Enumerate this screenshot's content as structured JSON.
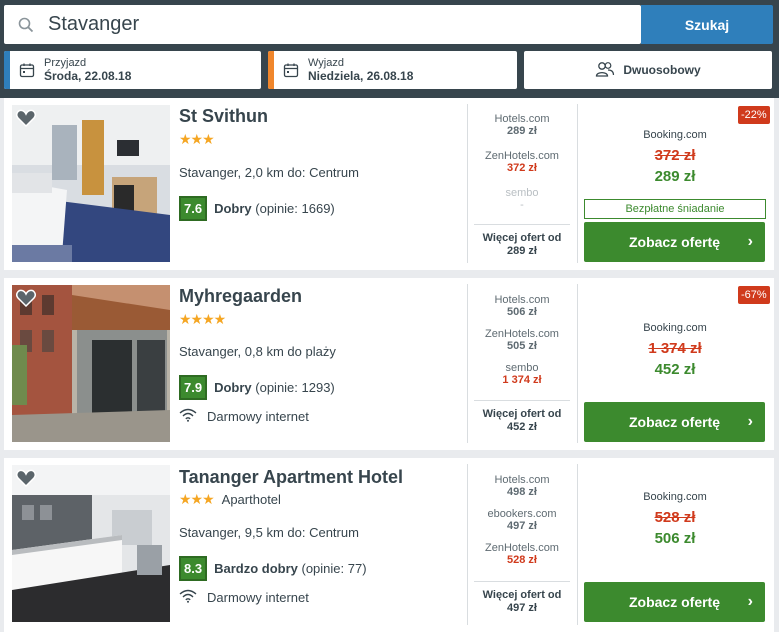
{
  "search": {
    "value": "Stavanger",
    "button_label": "Szukaj"
  },
  "checkin": {
    "label": "Przyjazd",
    "value": "Środa, 22.08.18",
    "accent": "#2f7fbb"
  },
  "checkout": {
    "label": "Wyjazd",
    "value": "Niedziela, 26.08.18",
    "accent": "#f0862c"
  },
  "room": {
    "value": "Dwuosobowy"
  },
  "hotels": [
    {
      "name": "St Svithun",
      "stars": "★★★",
      "type": "",
      "location": "Stavanger, 2,0 km do: Centrum",
      "score": "7.6",
      "rating_word": "Dobry",
      "reviews": "(opinie: 1669)",
      "amenity": "",
      "offers": [
        {
          "site": "Hotels.com",
          "price": "289 zł"
        },
        {
          "site": "ZenHotels.com",
          "price": "372 zł"
        },
        {
          "site": "sembo",
          "price": "-"
        }
      ],
      "more_label": "Więcej ofert od",
      "more_price": "289 zł",
      "discount": "-22%",
      "main_site": "Booking.com",
      "old_price": "372 zł",
      "new_price": "289 zł",
      "breakfast": "Bezpłatne śniadanie",
      "cta": "Zobacz ofertę"
    },
    {
      "name": "Myhregaarden",
      "stars": "★★★★",
      "type": "",
      "location": "Stavanger, 0,8 km do plaży",
      "score": "7.9",
      "rating_word": "Dobry",
      "reviews": "(opinie: 1293)",
      "amenity": "Darmowy internet",
      "offers": [
        {
          "site": "Hotels.com",
          "price": "506 zł"
        },
        {
          "site": "ZenHotels.com",
          "price": "505 zł"
        },
        {
          "site": "sembo",
          "price": "1 374 zł"
        }
      ],
      "more_label": "Więcej ofert od",
      "more_price": "452 zł",
      "discount": "-67%",
      "main_site": "Booking.com",
      "old_price": "1 374 zł",
      "new_price": "452 zł",
      "breakfast": "",
      "cta": "Zobacz ofertę"
    },
    {
      "name": "Tananger Apartment Hotel",
      "stars": "★★★",
      "type": "Aparthotel",
      "location": "Stavanger, 9,5 km do: Centrum",
      "score": "8.3",
      "rating_word": "Bardzo dobry",
      "reviews": "(opinie: 77)",
      "amenity": "Darmowy internet",
      "offers": [
        {
          "site": "Hotels.com",
          "price": "498 zł"
        },
        {
          "site": "ebookers.com",
          "price": "497 zł"
        },
        {
          "site": "ZenHotels.com",
          "price": "528 zł"
        }
      ],
      "more_label": "Więcej ofert od",
      "more_price": "497 zł",
      "discount": "",
      "main_site": "Booking.com",
      "old_price": "528 zł",
      "new_price": "506 zł",
      "breakfast": "",
      "cta": "Zobacz ofertę"
    }
  ]
}
